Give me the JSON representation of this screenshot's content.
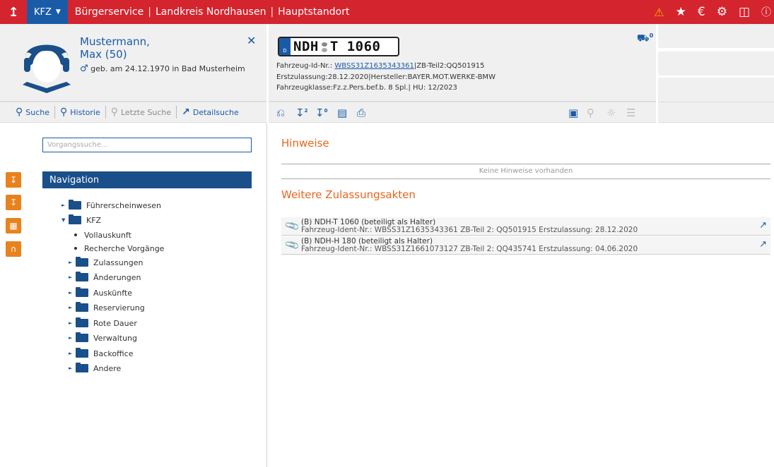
{
  "topbar": {
    "module": "KFZ",
    "crumbs": [
      "Bürgerservice",
      "Landkreis Nordhausen",
      "Hauptstandort"
    ]
  },
  "person": {
    "surname": "Mustermann,",
    "given": "Max (50)",
    "birth": "geb. am 24.12.1970 in Bad Musterheim"
  },
  "vehicle": {
    "plate_left": "NDH",
    "plate_right": "T 1060",
    "plate_country": "D",
    "id_label": "Fahrzeug-Id-Nr.: ",
    "id_value": "WBSS31Z1635343361",
    "id_suffix": "|ZB-Teil2:QQ501915",
    "line2": "Erstzulassung:28.12.2020|Hersteller:BAYER.MOT.WERKE-BMW",
    "line3": "Fahrzeugklasse:Fz.z.Pers.bef.b. 8 Spl.| HU: 12/2023",
    "car_count": "0"
  },
  "toolbar": {
    "search": "Suche",
    "history": "Historie",
    "last_search": "Letzte Suche",
    "detail_search": "Detailsuche",
    "badge1": "2",
    "badge2": "0"
  },
  "search": {
    "placeholder": "Vorgangssuche..."
  },
  "navigation": {
    "title": "Navigation",
    "items": [
      "Führerscheinwesen",
      "KFZ",
      "Vollauskunft",
      "Recherche Vorgänge",
      "Zulassungen",
      "Änderungen",
      "Auskünfte",
      "Reservierung",
      "Rote Dauer",
      "Verwaltung",
      "Backoffice",
      "Andere"
    ]
  },
  "main": {
    "hints_title": "Hinweise",
    "no_hints": "Keine Hinweise vorhanden",
    "files_title": "Weitere Zulassungsakten",
    "files": [
      {
        "title": "(B) NDH-T 1060 (beteiligt als Halter)",
        "detail": "Fahrzeug-Ident-Nr.: WBSS31Z1635343361 ZB-Teil 2: QQ501915 Erstzulassung: 28.12.2020"
      },
      {
        "title": "(B) NDH-H 180 (beteiligt als Halter)",
        "detail": "Fahrzeug-Ident-Nr.: WBSS31Z1661073127 ZB-Teil 2: QQ435741 Erstzulassung: 04.06.2020"
      }
    ]
  },
  "colors": {
    "topbar": "#d4242e",
    "accent_blue": "#1a5ba8",
    "section_orange": "#e8661e",
    "side_tab_orange": "#e8821e"
  }
}
